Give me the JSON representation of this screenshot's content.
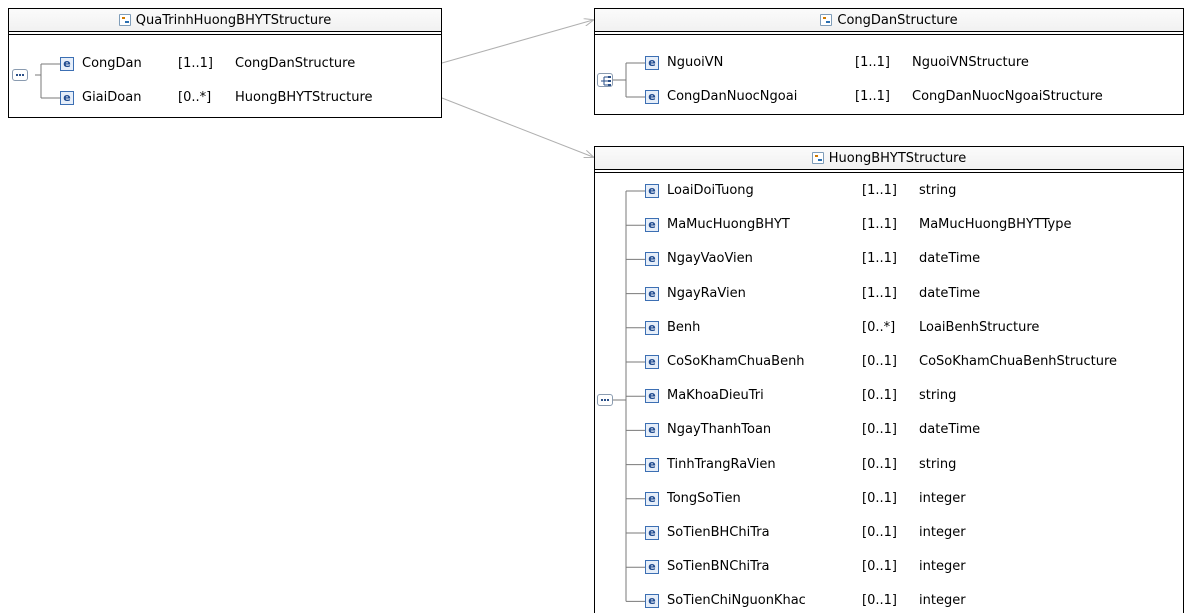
{
  "qua_trinh": {
    "title": "QuaTrinhHuongBHYTStructure",
    "rows": [
      {
        "name": "CongDan",
        "card": "[1..1]",
        "type": "CongDanStructure"
      },
      {
        "name": "GiaiDoan",
        "card": "[0..*]",
        "type": "HuongBHYTStructure"
      }
    ]
  },
  "cong_dan": {
    "title": "CongDanStructure",
    "rows": [
      {
        "name": "NguoiVN",
        "card": "[1..1]",
        "type": "NguoiVNStructure"
      },
      {
        "name": "CongDanNuocNgoai",
        "card": "[1..1]",
        "type": "CongDanNuocNgoaiStructure"
      }
    ]
  },
  "huong": {
    "title": "HuongBHYTStructure",
    "rows": [
      {
        "name": "LoaiDoiTuong",
        "card": "[1..1]",
        "type": "string"
      },
      {
        "name": "MaMucHuongBHYT",
        "card": "[1..1]",
        "type": "MaMucHuongBHYTType"
      },
      {
        "name": "NgayVaoVien",
        "card": "[1..1]",
        "type": "dateTime"
      },
      {
        "name": "NgayRaVien",
        "card": "[1..1]",
        "type": "dateTime"
      },
      {
        "name": "Benh",
        "card": "[0..*]",
        "type": "LoaiBenhStructure"
      },
      {
        "name": "CoSoKhamChuaBenh",
        "card": "[0..1]",
        "type": "CoSoKhamChuaBenhStructure"
      },
      {
        "name": "MaKhoaDieuTri",
        "card": "[0..1]",
        "type": "string"
      },
      {
        "name": "NgayThanhToan",
        "card": "[0..1]",
        "type": "dateTime"
      },
      {
        "name": "TinhTrangRaVien",
        "card": "[0..1]",
        "type": "string"
      },
      {
        "name": "TongSoTien",
        "card": "[0..1]",
        "type": "integer"
      },
      {
        "name": "SoTienBHChiTra",
        "card": "[0..1]",
        "type": "integer"
      },
      {
        "name": "SoTienBNChiTra",
        "card": "[0..1]",
        "type": "integer"
      },
      {
        "name": "SoTienChiNguonKhac",
        "card": "[0..1]",
        "type": "integer"
      }
    ]
  },
  "icons": {
    "type_icon": "complex-type-icon",
    "element_icon": "element-icon",
    "element_glyph": "e",
    "sequence_icon": "sequence-compositor-icon",
    "choice_icon": "choice-compositor-icon"
  },
  "colors": {
    "border": "#000000",
    "connector": "#b0b0b0",
    "element_icon": "#3c6fb3"
  }
}
